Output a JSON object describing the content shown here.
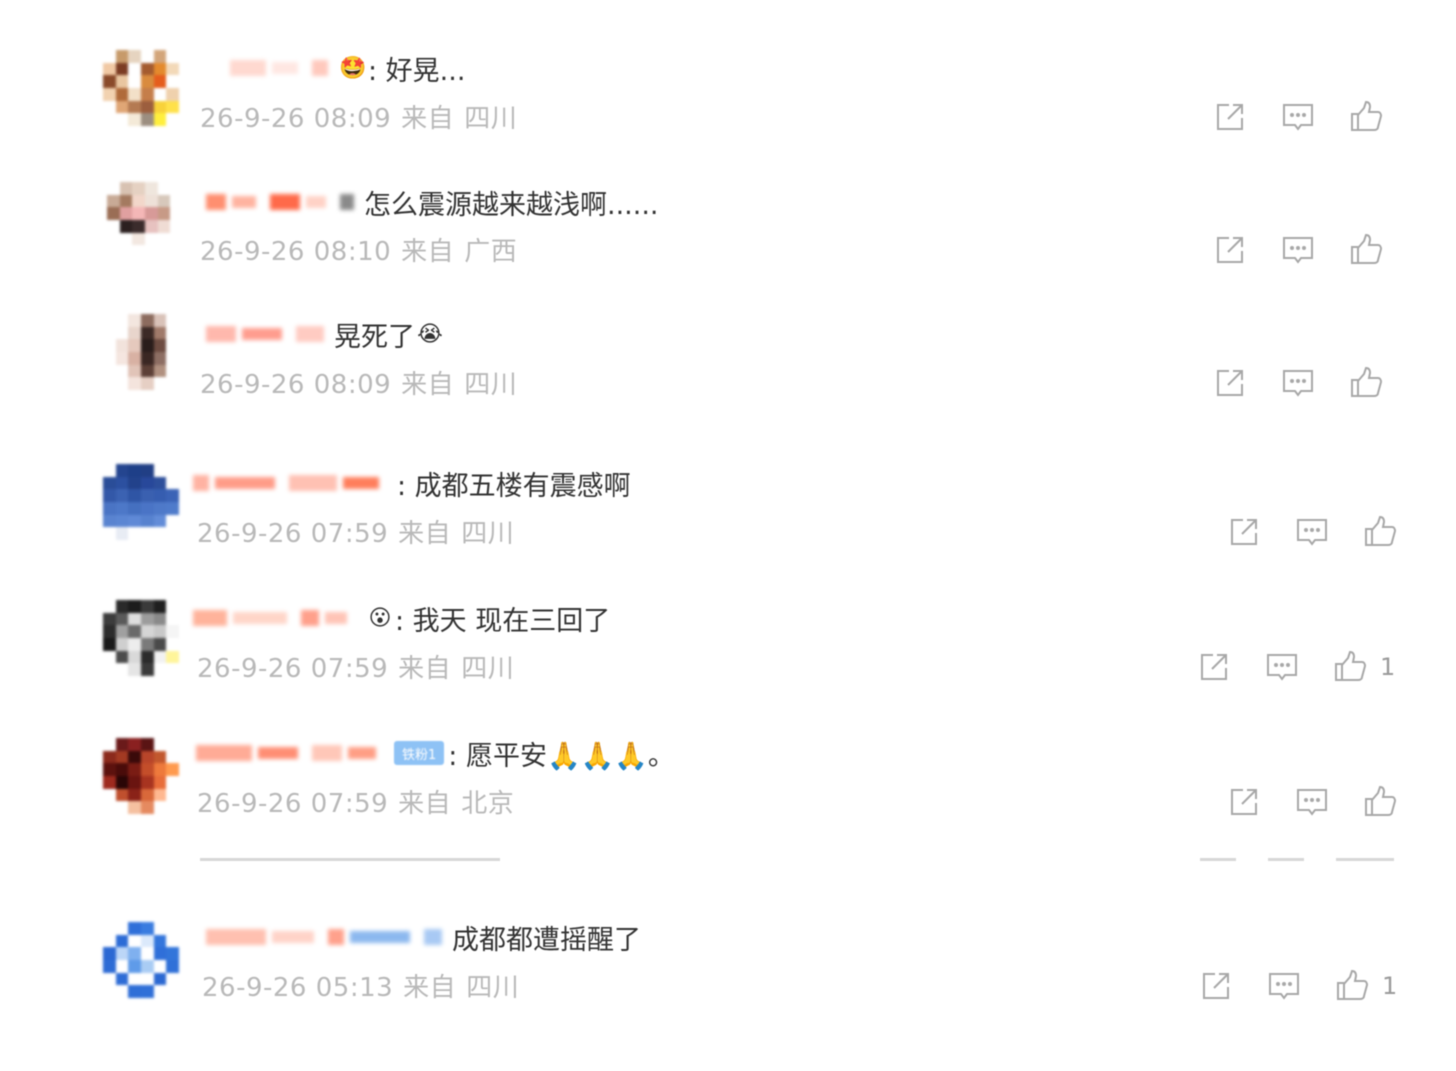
{
  "comments": [
    {
      "text": ": 好晃...",
      "time": "26-9-26 08:09",
      "source_label": "来自",
      "location": "四川",
      "has_emoji": true,
      "emoji": "🤩",
      "like_count": "",
      "avatar_colors": [
        "#ffffff",
        "#c79a6a",
        "#e6d4c0",
        "#ffffff",
        "#d3a57a",
        "#ffffff",
        "#f1c9a4",
        "#7b3c23",
        "#ffffff",
        "#a45b2f",
        "#e48a2d",
        "#f3d9b8",
        "#8a4a2a",
        "#e9c6a0",
        "#ffffff",
        "#d98b3e",
        "#e55d1d",
        "#ffffff",
        "#f2d2b0",
        "#b06a3a",
        "#f3e0c8",
        "#c57e4a",
        "#ffffff",
        "#efd1ad",
        "#ffffff",
        "#e0a676",
        "#b47a52",
        "#9c5e3e",
        "#f8d23a",
        "#ffe14a",
        "#ffffff",
        "#ffffff",
        "#f4ead8",
        "#9c8e80",
        "#ffef3d",
        "#ffffff"
      ],
      "name_colors": [
        "#ffd9d0",
        "#ffe7e2",
        "#ffc9bd"
      ]
    },
    {
      "text": "怎么震源越来越浅啊......",
      "time": "26-9-26 08:10",
      "source_label": "来自",
      "location": "广西",
      "has_emoji": false,
      "emoji": "",
      "like_count": "",
      "avatar_colors": [
        "#ffffff",
        "#d8c2b2",
        "#e5d1c2",
        "#efe6dd",
        "#ffffff",
        "#ffffff",
        "#c8aa96",
        "#a47a60",
        "#f2d7ca",
        "#eee1d8",
        "#d7c8bb",
        "#ffffff",
        "#9a6d55",
        "#e0a0a0",
        "#f4b7b7",
        "#d79a98",
        "#c79a86",
        "#ffffff",
        "#ffffff",
        "#2b2020",
        "#3b2c2c",
        "#e7c2c0",
        "#efdcd4",
        "#ffffff",
        "#ffffff",
        "#ffffff",
        "#f3e8e1",
        "#ffffff",
        "#ffffff",
        "#ffffff",
        "#ffffff",
        "#ffffff",
        "#ffffff",
        "#ffffff",
        "#ffffff",
        "#ffffff"
      ],
      "name_colors": [
        "#ff8f70",
        "#ffb3a0",
        "#ff6a4a",
        "#ffd2c6",
        "#8a8a8a"
      ]
    },
    {
      "text": "晃死了",
      "time": "26-9-26 08:09",
      "source_label": "来自",
      "location": "四川",
      "has_emoji": true,
      "emoji": "😭",
      "like_count": "",
      "avatar_colors": [
        "#ffffff",
        "#ffffff",
        "#f3e6df",
        "#8c6b5e",
        "#d9c2b8",
        "#ffffff",
        "#ffffff",
        "#ffffff",
        "#e8d5cc",
        "#3c2a26",
        "#a07a6a",
        "#ffffff",
        "#ffffff",
        "#f2e3dc",
        "#e5c9bd",
        "#2a1d1b",
        "#6d4c41",
        "#ffffff",
        "#ffffff",
        "#f5e6e0",
        "#d8b1a3",
        "#3a2723",
        "#8d6e63",
        "#ffffff",
        "#ffffff",
        "#ffffff",
        "#e1c4b8",
        "#5d4037",
        "#b0907f",
        "#ffffff",
        "#ffffff",
        "#ffffff",
        "#f4e4dd",
        "#e6cfc4",
        "#ffffff",
        "#ffffff"
      ],
      "name_colors": [
        "#ffb8ad",
        "#ff9d8f",
        "#ffcbc2"
      ]
    },
    {
      "text": ": 成都五楼有震感啊",
      "time": "26-9-26 07:59",
      "source_label": "来自",
      "location": "四川",
      "has_emoji": false,
      "emoji": "",
      "like_count": "",
      "avatar_colors": [
        "#ffffff",
        "#24458f",
        "#1e3f88",
        "#213f85",
        "#ffffff",
        "#ffffff",
        "#2a4d98",
        "#2c50a0",
        "#22428b",
        "#28489a",
        "#2d4f9b",
        "#ffffff",
        "#3358a8",
        "#3b62b2",
        "#2f55a5",
        "#3a60b0",
        "#365db0",
        "#3b63b6",
        "#4a74c4",
        "#4d78c8",
        "#4570c0",
        "#4a74c6",
        "#4e79c9",
        "#4f7bcb",
        "#5983d0",
        "#5b86d3",
        "#5f89d6",
        "#5782cf",
        "#628cd8",
        "#ffffff",
        "#ffffff",
        "#e8ecf4",
        "#ffffff",
        "#ffffff",
        "#ffffff",
        "#ffffff"
      ],
      "name_colors": [
        "#ffb2a2",
        "#ff9c88",
        "#ffc1b3",
        "#ff7e5c"
      ]
    },
    {
      "text": ": 我天 现在三回了",
      "time": "26-9-26 07:59",
      "source_label": "来自",
      "location": "四川",
      "has_emoji": true,
      "emoji": "😮",
      "like_count": "1",
      "avatar_colors": [
        "#ffffff",
        "#2a2a2a",
        "#1c1c1c",
        "#3a3a3a",
        "#1f1f1f",
        "#ffffff",
        "#3c3c3c",
        "#5a5a5a",
        "#dedede",
        "#9c9c9c",
        "#8a8a8a",
        "#ffffff",
        "#2c2c2c",
        "#a0a0a0",
        "#6a6a6a",
        "#d5d5d5",
        "#c8c8c8",
        "#f5f5f5",
        "#1a1a1a",
        "#cfcfcf",
        "#ededed",
        "#7a7a7a",
        "#4a4a4a",
        "#ffffff",
        "#ffffff",
        "#4b4b4b",
        "#d9d9d9",
        "#2b2b2b",
        "#f2f2f2",
        "#fff59a",
        "#ffffff",
        "#ffffff",
        "#e5e5e5",
        "#3a3a3a",
        "#ffffff",
        "#ffffff"
      ],
      "name_colors": [
        "#ffb39b",
        "#ffd5c8",
        "#ffa08b",
        "#ffc4b6"
      ]
    },
    {
      "text": ": 愿平安🙏🙏🙏。",
      "time": "26-9-26 07:59",
      "source_label": "来自",
      "location": "北京",
      "has_emoji": false,
      "emoji": "",
      "like_count": "",
      "badge": "铁粉1",
      "avatar_colors": [
        "#ffffff",
        "#6a1a1a",
        "#8a2020",
        "#5a1414",
        "#ffffff",
        "#ffffff",
        "#8b2a1c",
        "#a33a22",
        "#3a0a0a",
        "#b8452a",
        "#c2582e",
        "#ffffff",
        "#5c120e",
        "#4a0c0a",
        "#7a1c14",
        "#c44e2a",
        "#ee7a3c",
        "#ff9a4e",
        "#9e2a1e",
        "#2a0606",
        "#6a1410",
        "#a83420",
        "#e86d3a",
        "#ffffff",
        "#ffffff",
        "#c0502e",
        "#8a2218",
        "#d9683a",
        "#ffb890",
        "#ffffff",
        "#ffffff",
        "#ffffff",
        "#f5c0a0",
        "#e58a60",
        "#ffffff",
        "#ffffff"
      ],
      "name_colors": [
        "#ffab96",
        "#ff8e74",
        "#ffc7b8",
        "#ff9e85"
      ]
    },
    {
      "text": "成都都遭摇醒了",
      "time": "26-9-26 05:13",
      "source_label": "来自",
      "location": "四川",
      "has_emoji": false,
      "emoji": "",
      "like_count": "1",
      "avatar_colors": [
        "#ffffff",
        "#ffffff",
        "#2f6fd9",
        "#3a7ce0",
        "#ffffff",
        "#ffffff",
        "#ffffff",
        "#2c6bd6",
        "#ffffff",
        "#dbe9fb",
        "#3476dc",
        "#ffffff",
        "#2b68d3",
        "#bcd6f7",
        "#7fb0ef",
        "#ffffff",
        "#2f6fd9",
        "#3275da",
        "#2d6bd5",
        "#ffffff",
        "#5f9be9",
        "#a9ccf4",
        "#ffffff",
        "#2f70d8",
        "#ffffff",
        "#2e6cd6",
        "#ffffff",
        "#ffffff",
        "#2b68d2",
        "#ffffff",
        "#ffffff",
        "#ffffff",
        "#2e6ed7",
        "#3070d8",
        "#ffffff",
        "#ffffff"
      ],
      "name_colors": [
        "#ffc0b0",
        "#ffd3c8",
        "#ffa18c",
        "#8cb8ef",
        "#a8c9f4"
      ]
    }
  ],
  "icons": {
    "share": "share-icon",
    "reply": "comment-icon",
    "like": "like-icon"
  }
}
